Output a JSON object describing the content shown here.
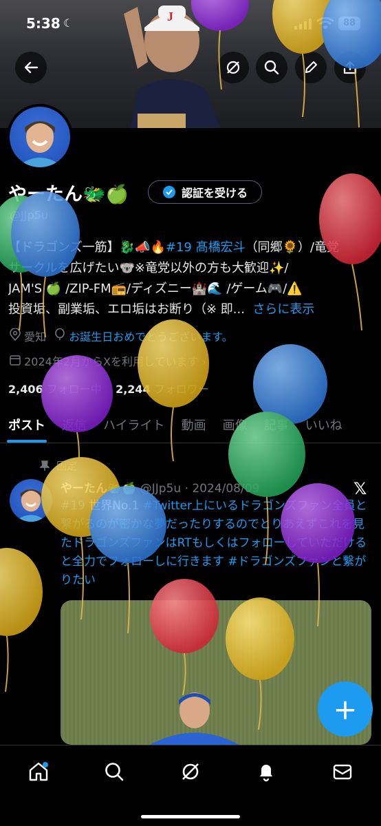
{
  "status_bar": {
    "time": "5:38",
    "battery": "88"
  },
  "profile": {
    "name": "やーたん🐲🍏",
    "verify_label": "認証を受ける",
    "handle": "@JJp5u",
    "bio_lines": [
      [
        "【ドラゴンズ一筋】🐉📣🔥",
        "#19 髙橋宏斗",
        "（同郷🌻）/竜党"
      ],
      [
        "サークルを広げたい🐨※竜党以外の方も大歓迎✨/"
      ],
      [
        "JAM'S 🍏 /ZIP-FM📻/ディズニー🏰🌊 /ゲーム🎮/⚠️"
      ],
      [
        "投資垢、副業垢、エロ垢はお断り（※ 即...",
        "さらに表示"
      ]
    ],
    "location": "愛知",
    "birthday_text": "お誕生日おめでとうございます。",
    "joined": "2024年2月からXを利用しています",
    "following_count": "2,406",
    "following_label": "フォロー中",
    "followers_count": "2,244",
    "followers_label": "フォロワー"
  },
  "tabs": [
    "ポスト",
    "返信",
    "ハイライト",
    "動画",
    "画像",
    "記事",
    "いいね"
  ],
  "post": {
    "pinned_label": "固定",
    "author": "やーたん🐲🍏",
    "handle_date": "@JJp5u · 2024/08/09",
    "text_parts": [
      {
        "t": "#19",
        "blue": true
      },
      {
        "t": " 世界No.1 ",
        "blue": false
      },
      {
        "t": "#Twitter上にいるドラゴンズファン全員と繋がるのが密かな夢だったりするのでとりあえずこれを見たドラゴンズファンはRTもしくはフォローしていただけると全力でフォローしに行きます",
        "blue": true
      },
      {
        "t": " ",
        "blue": false
      },
      {
        "t": "#ドラゴンズファンと繋がりたい",
        "blue": true
      }
    ]
  },
  "colors": {
    "accent": "#1d9bf0",
    "balloons": [
      "#9b30e0",
      "#e8c02a",
      "#3f8fe8",
      "#e8404c",
      "#38c06a"
    ]
  },
  "icons": [
    "back-arrow-icon",
    "grok-icon",
    "search-icon",
    "pencil-icon",
    "share-icon",
    "x-logo-icon",
    "home-icon",
    "explore-icon",
    "grok-nav-icon",
    "bell-icon",
    "mail-icon",
    "plus-icon"
  ]
}
